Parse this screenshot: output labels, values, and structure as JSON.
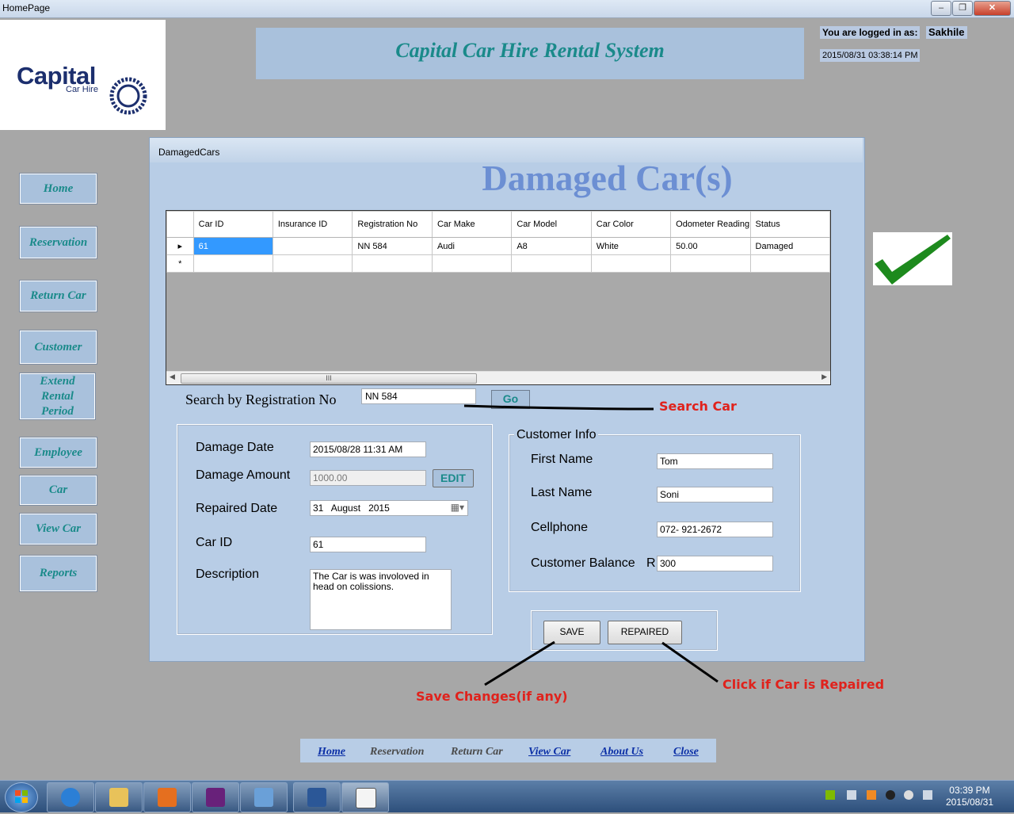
{
  "window": {
    "title": "HomePage"
  },
  "header": {
    "logo_word": "Capital",
    "logo_sub": "Car Hire",
    "app_title": "Capital Car Hire Rental System",
    "logged_in_label": "You are logged in as:",
    "logged_in_user": "Sakhile",
    "datetime": "2015/08/31 03:38:14 PM"
  },
  "sidebar": {
    "items": [
      {
        "label": "Home"
      },
      {
        "label": "Reservation"
      },
      {
        "label": "Return Car"
      },
      {
        "label": "Customer"
      },
      {
        "label": "Extend Rental Period"
      },
      {
        "label": "Employee"
      },
      {
        "label": "Car"
      },
      {
        "label": "View Car"
      },
      {
        "label": "Reports"
      }
    ]
  },
  "child_window": {
    "title": "DamagedCars",
    "heading": "Damaged Car(s)"
  },
  "grid": {
    "columns": [
      "Car ID",
      "Insurance ID",
      "Registration No",
      "Car Make",
      "Car Model",
      "Car Color",
      "Odometer Reading",
      "Status"
    ],
    "rows": [
      [
        "61",
        "",
        "NN 584",
        "Audi",
        "A8",
        "White",
        "50.00",
        "Damaged"
      ]
    ],
    "new_row_marker": "*",
    "scroll_thumb": "III"
  },
  "search": {
    "label": "Search by Registration No",
    "value": "NN 584",
    "go_label": "Go"
  },
  "damage": {
    "date_label": "Damage Date",
    "date_value": "2015/08/28 11:31 AM",
    "amount_label": "Damage Amount",
    "amount_value": "1000.00",
    "edit_label": "EDIT",
    "repaired_label": "Repaired Date",
    "repaired_day": "31",
    "repaired_month": "August",
    "repaired_year": "2015",
    "carid_label": "Car ID",
    "carid_value": "61",
    "desc_label": "Description",
    "desc_value": "The Car is was involoved in head on colissions."
  },
  "customer": {
    "group_title": "Customer Info",
    "first_label": "First Name",
    "first_value": "Tom",
    "last_label": "Last Name",
    "last_value": "Soni",
    "cell_label": "Cellphone",
    "cell_value": "072- 921-2672",
    "balance_label": "Customer Balance",
    "balance_currency": "R",
    "balance_value": "300"
  },
  "actions": {
    "save_label": "SAVE",
    "repaired_label": "REPAIRED"
  },
  "annotations": {
    "search": "Search Car",
    "save": "Save Changes(if any)",
    "repaired": "Click if Car is Repaired"
  },
  "bottom_nav": {
    "home": "Home",
    "reservation": "Reservation",
    "return_car": "Return Car",
    "view_car": "View Car",
    "about": "About Us",
    "close": "Close"
  },
  "taskbar": {
    "time": "03:39 PM",
    "date": "2015/08/31"
  },
  "colors": {
    "accent_text": "#1a8a8a",
    "heading": "#6c8fd3",
    "annotation": "#e0221c",
    "panel": "#b8cde6"
  }
}
